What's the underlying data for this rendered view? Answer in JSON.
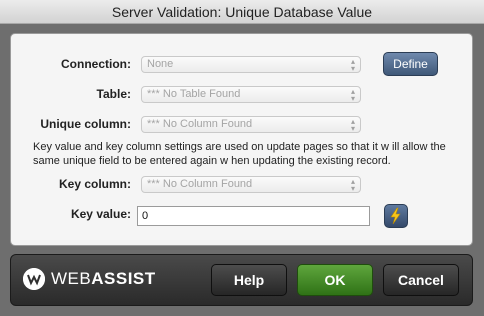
{
  "window": {
    "title": "Server Validation: Unique Database Value"
  },
  "form": {
    "connection": {
      "label": "Connection:",
      "value": "None"
    },
    "define_label": "Define",
    "table": {
      "label": "Table:",
      "value": "*** No Table Found"
    },
    "unique_column": {
      "label": "Unique column:",
      "value": "*** No Column Found"
    },
    "note": "Key value and key column settings are used on update pages so that it w ill allow  the same unique field to be entered again w hen updating the existing record.",
    "key_column": {
      "label": "Key column:",
      "value": "*** No Column Found"
    },
    "key_value": {
      "label": "Key value:",
      "value": "0"
    }
  },
  "footer": {
    "brand_light": "WEB",
    "brand_bold": "ASSIST",
    "help_label": "Help",
    "ok_label": "OK",
    "cancel_label": "Cancel"
  },
  "colors": {
    "ok_green": "#4a9a2a",
    "define_blue": "#4e6a8e",
    "bolt_yellow": "#f7c61b"
  },
  "icons": {
    "select_arrows": "updown-arrows-icon",
    "bolt": "lightning-bolt-icon",
    "logo": "webassist-logo-icon"
  }
}
